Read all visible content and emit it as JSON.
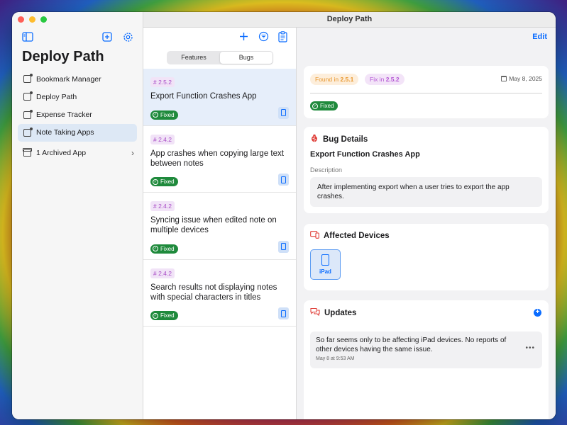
{
  "window": {
    "title": "Deploy Path"
  },
  "sidebar": {
    "title": "Deploy Path",
    "items": [
      {
        "label": "Bookmark Manager"
      },
      {
        "label": "Deploy Path"
      },
      {
        "label": "Expense Tracker"
      },
      {
        "label": "Note Taking Apps"
      }
    ],
    "archived": {
      "label": "1 Archived App"
    }
  },
  "middle": {
    "tabs": [
      {
        "label": "Features"
      },
      {
        "label": "Bugs"
      }
    ],
    "bugs": [
      {
        "version": "# 2.5.2",
        "title": "Export Function Crashes App",
        "status": "Fixed"
      },
      {
        "version": "# 2.4.2",
        "title": "App crashes when copying large text between notes",
        "status": "Fixed"
      },
      {
        "version": "# 2.4.2",
        "title": "Syncing issue when edited note on multiple devices",
        "status": "Fixed"
      },
      {
        "version": "# 2.4.2",
        "title": "Search results not displaying notes with special characters in titles",
        "status": "Fixed"
      }
    ]
  },
  "detail": {
    "edit_label": "Edit",
    "found_prefix": "Found in",
    "found_version": "2.5.1",
    "fix_prefix": "Fix in",
    "fix_version": "2.5.2",
    "date": "May 8, 2025",
    "status": "Fixed",
    "bug_details": {
      "heading": "Bug Details",
      "name": "Export Function Crashes App",
      "description_label": "Description",
      "description": "After implementing export when a user tries to export the app crashes."
    },
    "affected": {
      "heading": "Affected Devices",
      "devices": [
        {
          "label": "iPad"
        }
      ]
    },
    "updates": {
      "heading": "Updates",
      "items": [
        {
          "text": "So far seems only to be affecting iPad devices. No reports of other devices having the same issue.",
          "time": "May 8 at 9:53 AM"
        }
      ]
    }
  },
  "colors": {
    "accent": "#0a6cff",
    "fixed": "#1f8a3c",
    "version_tag": "#a94ec7",
    "found": "#e8962c",
    "fix": "#b455d4",
    "bug_icon": "#e0403a"
  }
}
